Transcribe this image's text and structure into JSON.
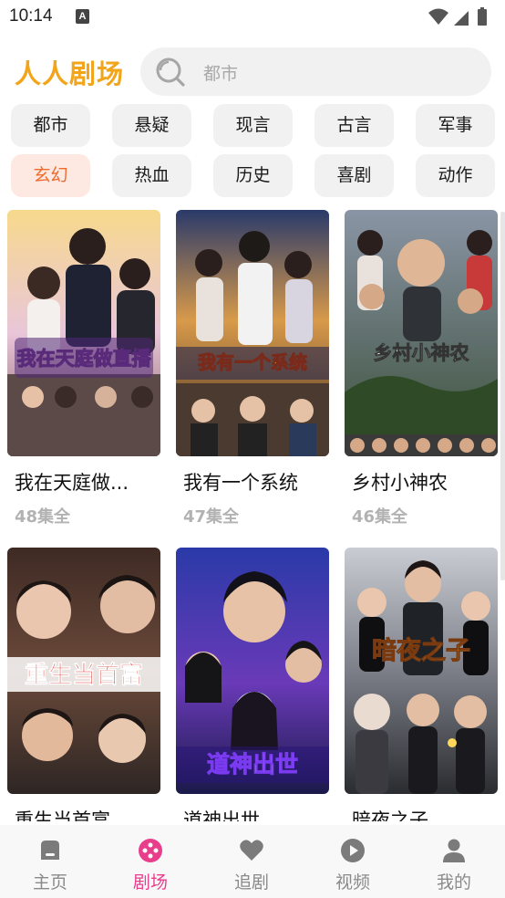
{
  "status_bar": {
    "time": "10:14",
    "notification_icon": "a-letter-icon"
  },
  "header": {
    "title": "人人剧场",
    "search": {
      "placeholder": "都市",
      "icon": "search-icon"
    }
  },
  "categories": {
    "items": [
      "都市",
      "悬疑",
      "现言",
      "古言",
      "军事",
      "玄幻",
      "热血",
      "历史",
      "喜剧",
      "动作"
    ],
    "active": "玄幻",
    "active_color": "#ef6a2d",
    "active_bg": "#fde9e1"
  },
  "dramas": [
    {
      "title": "我在天庭做...",
      "count": "48集全",
      "poster_text": "我在天庭做直播"
    },
    {
      "title": "我有一个系统",
      "count": "47集全",
      "poster_text": "我有一个系统"
    },
    {
      "title": "乡村小神农",
      "count": "46集全",
      "poster_text": "乡村小神农"
    },
    {
      "title": "重生当首富",
      "count": "",
      "poster_text": "重生当首富"
    },
    {
      "title": "道神出世",
      "count": "",
      "poster_text": "道神出世"
    },
    {
      "title": "暗夜之子",
      "count": "",
      "poster_text": "暗夜之子"
    }
  ],
  "bottom_nav": {
    "items": [
      {
        "label": "主页",
        "icon": "home-icon"
      },
      {
        "label": "剧场",
        "icon": "theater-icon"
      },
      {
        "label": "追剧",
        "icon": "heart-icon"
      },
      {
        "label": "视频",
        "icon": "play-icon"
      },
      {
        "label": "我的",
        "icon": "person-icon"
      }
    ],
    "active_label": "剧场",
    "active_color": "#e83e8c"
  },
  "colors": {
    "brand": "#f2a51a",
    "text_muted": "#b2b2b2"
  }
}
